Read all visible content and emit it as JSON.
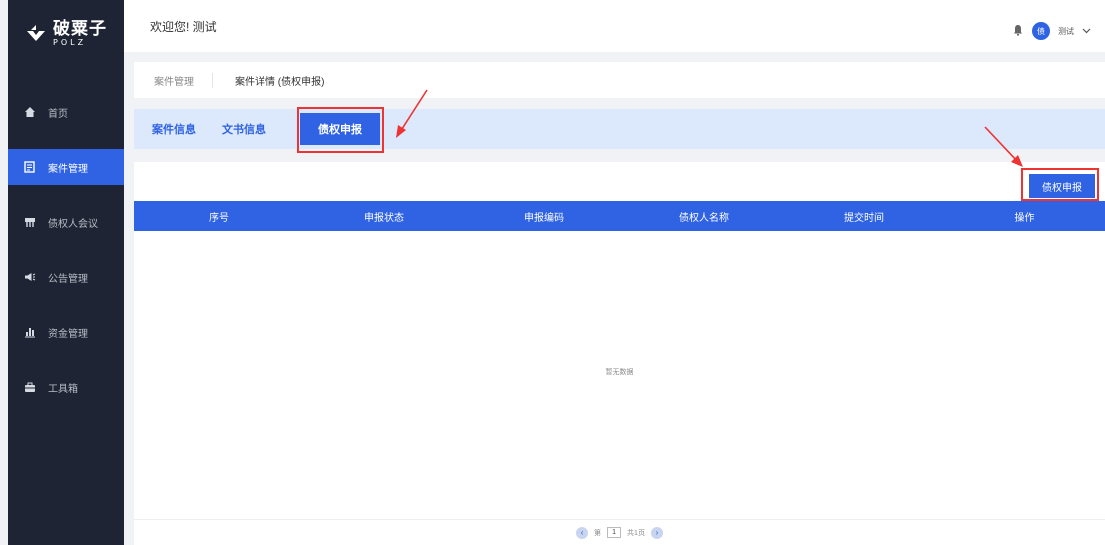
{
  "brand": {
    "name": "破粟子",
    "sub": "POLZ"
  },
  "header": {
    "welcome": "欢迎您! 测试",
    "avatar_text": "债",
    "username": "测试"
  },
  "sidebar": {
    "items": [
      {
        "label": "首页",
        "icon": "home-icon"
      },
      {
        "label": "案件管理",
        "icon": "case-icon",
        "active": true
      },
      {
        "label": "债权人会议",
        "icon": "meeting-icon"
      },
      {
        "label": "公告管理",
        "icon": "megaphone-icon"
      },
      {
        "label": "资金管理",
        "icon": "chart-icon"
      },
      {
        "label": "工具箱",
        "icon": "toolbox-icon"
      }
    ]
  },
  "breadcrumb": {
    "parent": "案件管理",
    "current": "案件详情 (债权申报)"
  },
  "tabs": [
    {
      "label": "案件信息"
    },
    {
      "label": "文书信息"
    },
    {
      "label": "债权申报",
      "active": true
    }
  ],
  "actions": {
    "declare_button": "债权申报"
  },
  "table": {
    "columns": [
      "序号",
      "申报状态",
      "申报编码",
      "债权人名称",
      "提交时间",
      "操作"
    ],
    "empty_text": "暂无数据"
  },
  "pager": {
    "page_prefix": "第",
    "page_value": "1",
    "page_total": "共1页"
  },
  "colors": {
    "accent": "#2f63e3",
    "sidebar": "#1e2433",
    "annotation": "#ee3333"
  }
}
